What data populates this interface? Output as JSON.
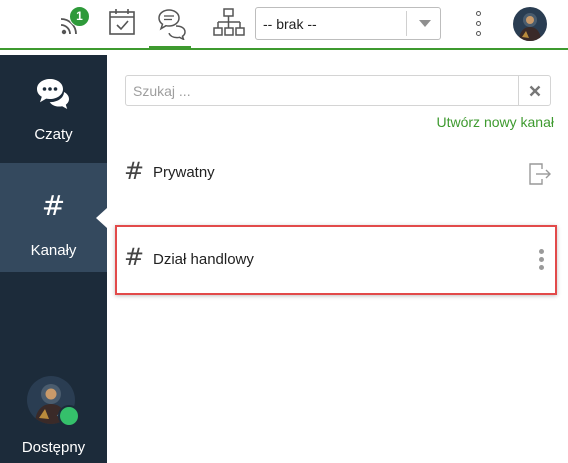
{
  "topbar": {
    "rss_badge_count": "1",
    "status_select": {
      "value": "-- brak --"
    },
    "active_icon_color": "#3e9a2f"
  },
  "sidebar": {
    "items": [
      {
        "id": "czaty",
        "label": "Czaty",
        "icon": "chat-bubbles-icon"
      },
      {
        "id": "kanaly",
        "label": "Kanały",
        "icon": "hash-icon"
      }
    ],
    "user_status": "Dostępny",
    "status_color": "#35c06b"
  },
  "main": {
    "search": {
      "placeholder": "Szukaj ...",
      "value": ""
    },
    "create_channel_label": "Utwórz nowy kanał",
    "channels": [
      {
        "name": "Prywatny",
        "action_icon": "leave-icon"
      },
      {
        "name": "Dział handlowy",
        "action_icon": "kebab-menu-icon",
        "highlighted": true
      }
    ],
    "hash_symbol": "#"
  },
  "colors": {
    "accent": "#3e9a2f",
    "sidebar_bg": "#1c2b3a",
    "sidebar_active_bg": "#34495e",
    "highlight_border": "#e24a4a"
  }
}
